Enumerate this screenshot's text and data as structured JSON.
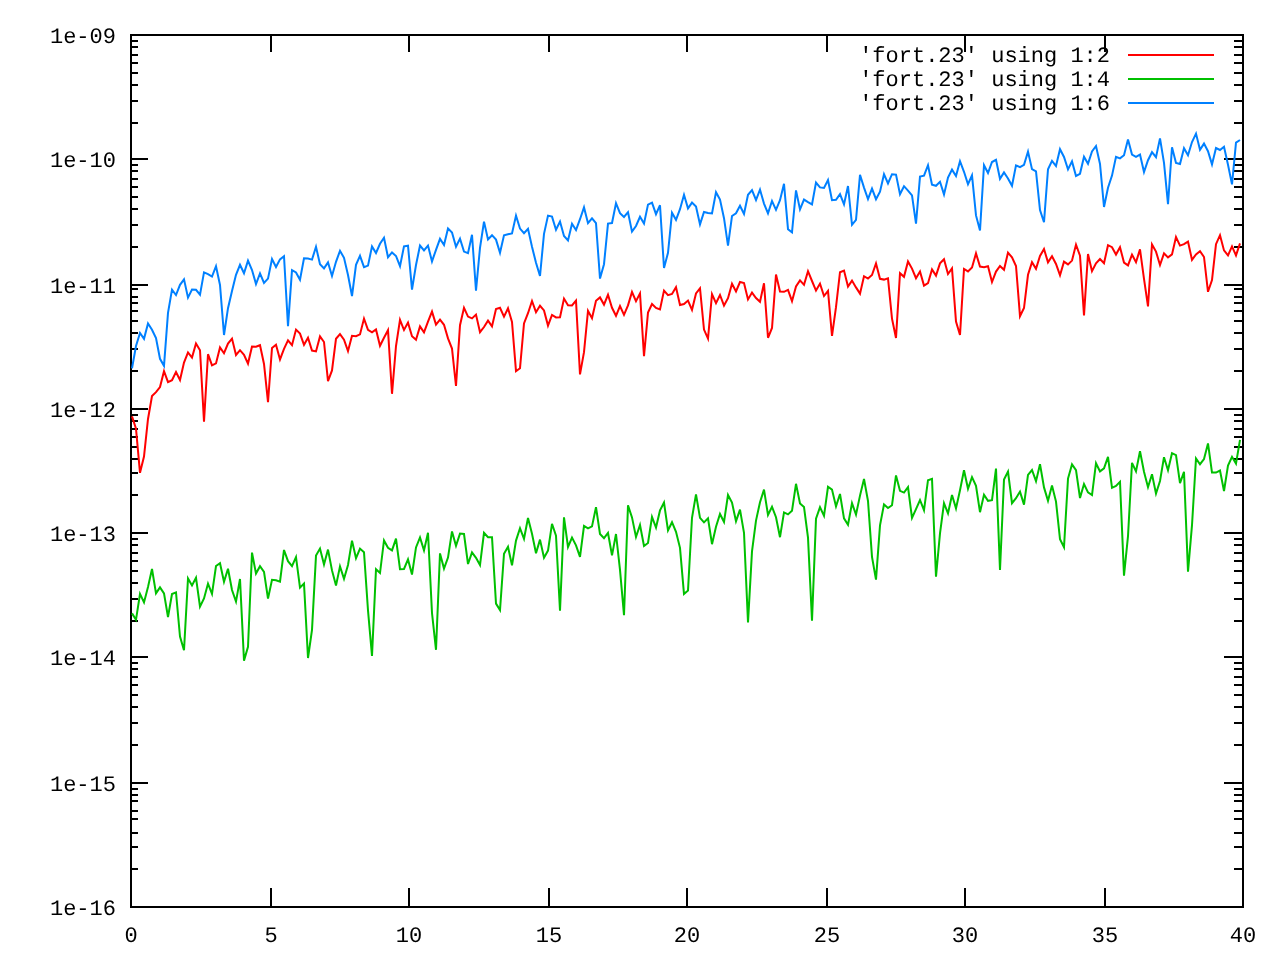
{
  "plot": {
    "y_tick_labels": [
      "1e-09",
      "1e-10",
      "1e-11",
      "1e-12",
      "1e-13",
      "1e-14",
      "1e-15",
      "1e-16"
    ],
    "x_tick_labels": [
      "0",
      "5",
      "10",
      "15",
      "20",
      "25",
      "30",
      "35",
      "40"
    ],
    "legend": [
      {
        "label": "'fort.23' using 1:2",
        "color": "#ff0000"
      },
      {
        "label": "'fort.23' using 1:4",
        "color": "#00c000"
      },
      {
        "label": "'fort.23' using 1:6",
        "color": "#0080ff"
      }
    ]
  }
}
